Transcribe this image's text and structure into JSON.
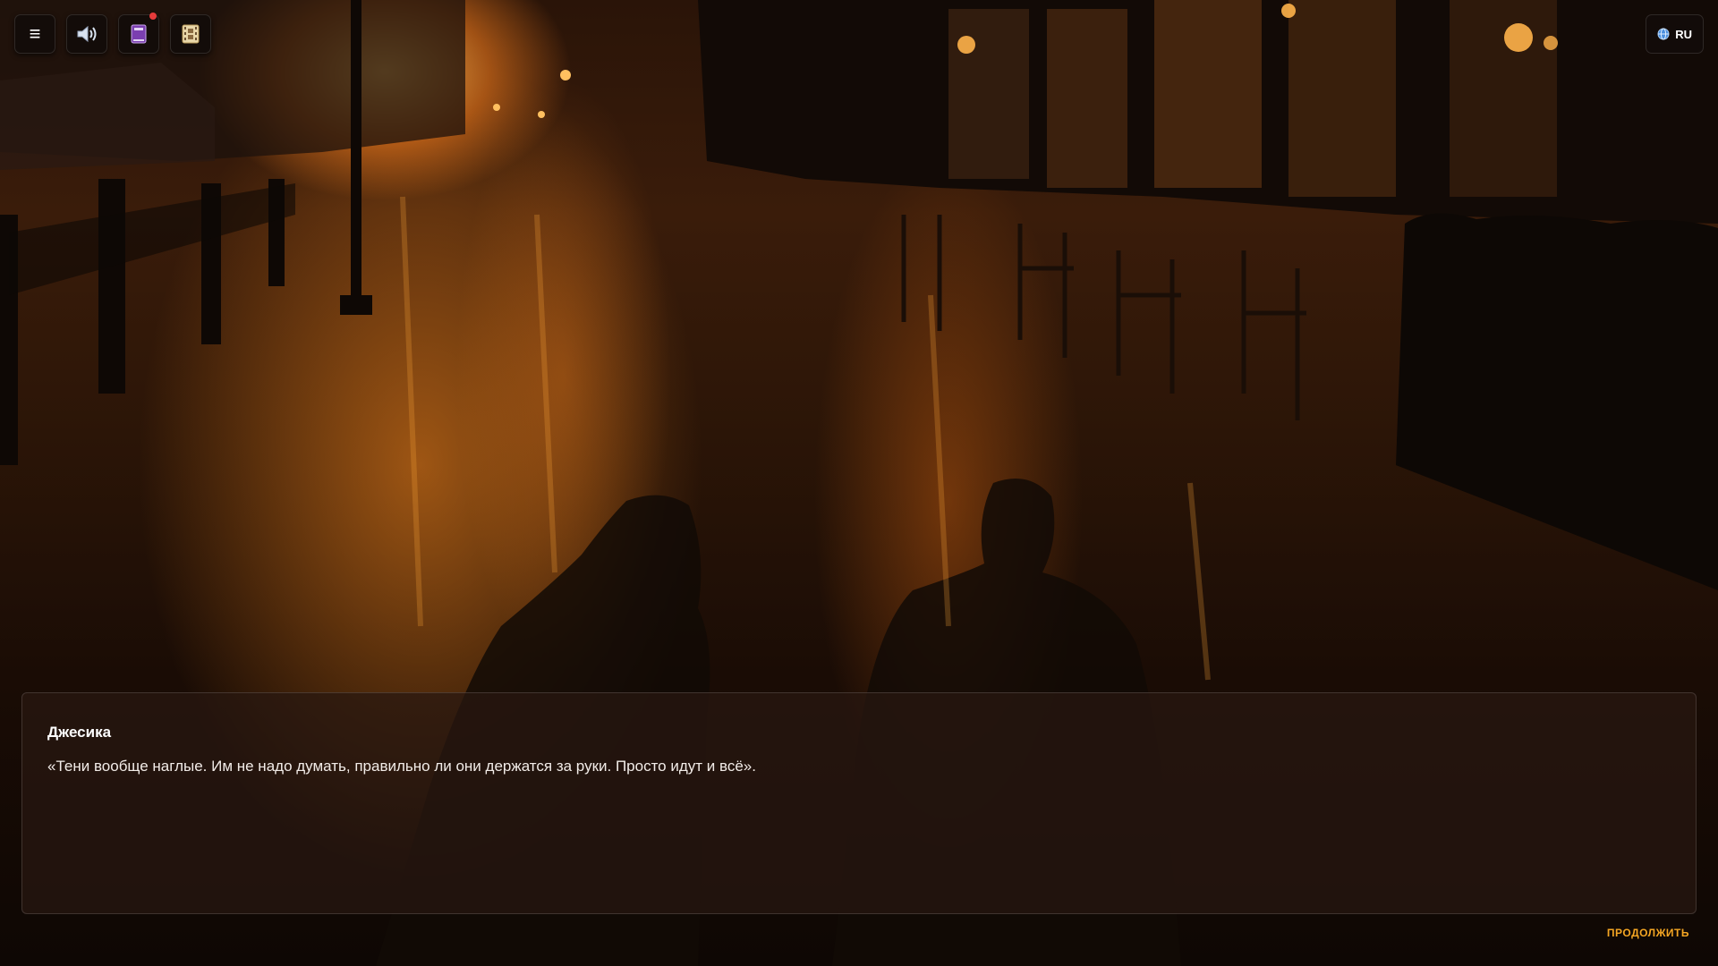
{
  "colors": {
    "accent": "#f5a623",
    "notification": "#e53b3b",
    "panel_bg": "#120c0a"
  },
  "toolbar": {
    "items": [
      {
        "name": "menu-button",
        "icon": "hamburger-menu-icon"
      },
      {
        "name": "sound-button",
        "icon": "speaker-icon"
      },
      {
        "name": "journal-button",
        "icon": "book-icon",
        "notification": true
      },
      {
        "name": "gallery-button",
        "icon": "film-icon"
      }
    ],
    "hamburger_glyph": "≡"
  },
  "language": {
    "icon": "globe-icon",
    "label": "RU"
  },
  "dialog": {
    "speaker": "Джесика",
    "text": "«Тени вообще наглые. Им не надо думать, правильно ли они держатся за руки. Просто идут и всё»."
  },
  "continue_label": "ПРОДОЛЖИТЬ"
}
